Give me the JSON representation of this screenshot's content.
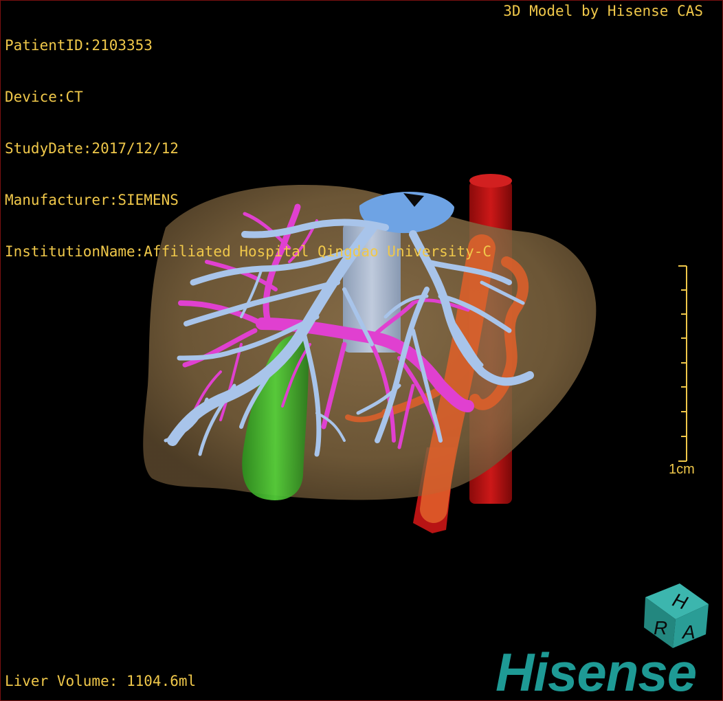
{
  "study_info": {
    "patient_id": "PatientID:2103353",
    "device": "Device:CT",
    "study_date": "StudyDate:2017/12/12",
    "manufacturer": "Manufacturer:SIEMENS",
    "institution": "InstitutionName:Affiliated Hospital Qingdao University-C"
  },
  "watermark": {
    "model_credit": "3D Model by Hisense CAS"
  },
  "measurements": {
    "liver_volume": "Liver Volume: 1104.6ml"
  },
  "scale_bar": {
    "label": "1cm"
  },
  "orientation_cube": {
    "face_letters": [
      "H",
      "R",
      "A"
    ]
  },
  "brand": {
    "name": "Hisense"
  },
  "colors": {
    "overlay_text": "#f0c84a",
    "frame_border": "#7a1010",
    "background": "#000000",
    "liver": "#8a6e48",
    "hepatic_vein": "#a8c4ea",
    "portal_vein": "#e040d0",
    "aorta": "#b01010",
    "ivc_orange": "#e0602a",
    "gallbladder": "#3fb52a",
    "brand_teal": "#1e9a95",
    "cube_teal": "#2a9d96"
  },
  "icons": {
    "orientation_cube": "orientation-cube-icon",
    "scale": "scale-bar-icon"
  }
}
